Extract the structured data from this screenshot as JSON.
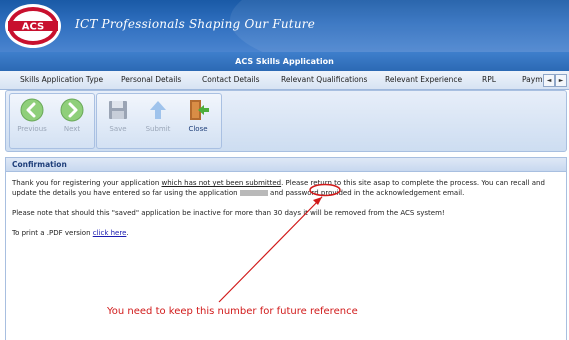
{
  "header": {
    "logo_text": "ACS",
    "tagline": "ICT Professionals Shaping Our Future"
  },
  "title_bar": {
    "title": "ACS Skills Application"
  },
  "tabs": {
    "items": [
      {
        "label": "Skills Application Type"
      },
      {
        "label": "Personal Details"
      },
      {
        "label": "Contact Details"
      },
      {
        "label": "Relevant Qualifications"
      },
      {
        "label": "Relevant Experience"
      },
      {
        "label": "RPL"
      },
      {
        "label": "Paym"
      }
    ],
    "scroll_left": "◄",
    "scroll_right": "►"
  },
  "toolbar": {
    "previous_label": "Previous",
    "next_label": "Next",
    "save_label": "Save",
    "submit_label": "Submit",
    "close_label": "Close"
  },
  "panel": {
    "title": "Confirmation",
    "para1_a": "Thank you for registering your application ",
    "para1_u": "which has not yet been submitted",
    "para1_b": ". Please return to this site asap to complete the process. You can recall and update the details you have entered so far using the application ",
    "para1_c": " and password provided in the acknowledgement email.",
    "para2": "Please note that should this \"saved\" application be inactive for more than 30 days it will be removed from the ACS system!",
    "print_prefix": "To print a .PDF version ",
    "print_link": "click here",
    "print_suffix": "."
  },
  "annotation": {
    "text": "You need to keep this number for future reference",
    "color": "#d11a1a"
  },
  "colors": {
    "brand_blue": "#2a66b4",
    "logo_red": "#c8102e",
    "panel_title": "#1f3f7a"
  }
}
